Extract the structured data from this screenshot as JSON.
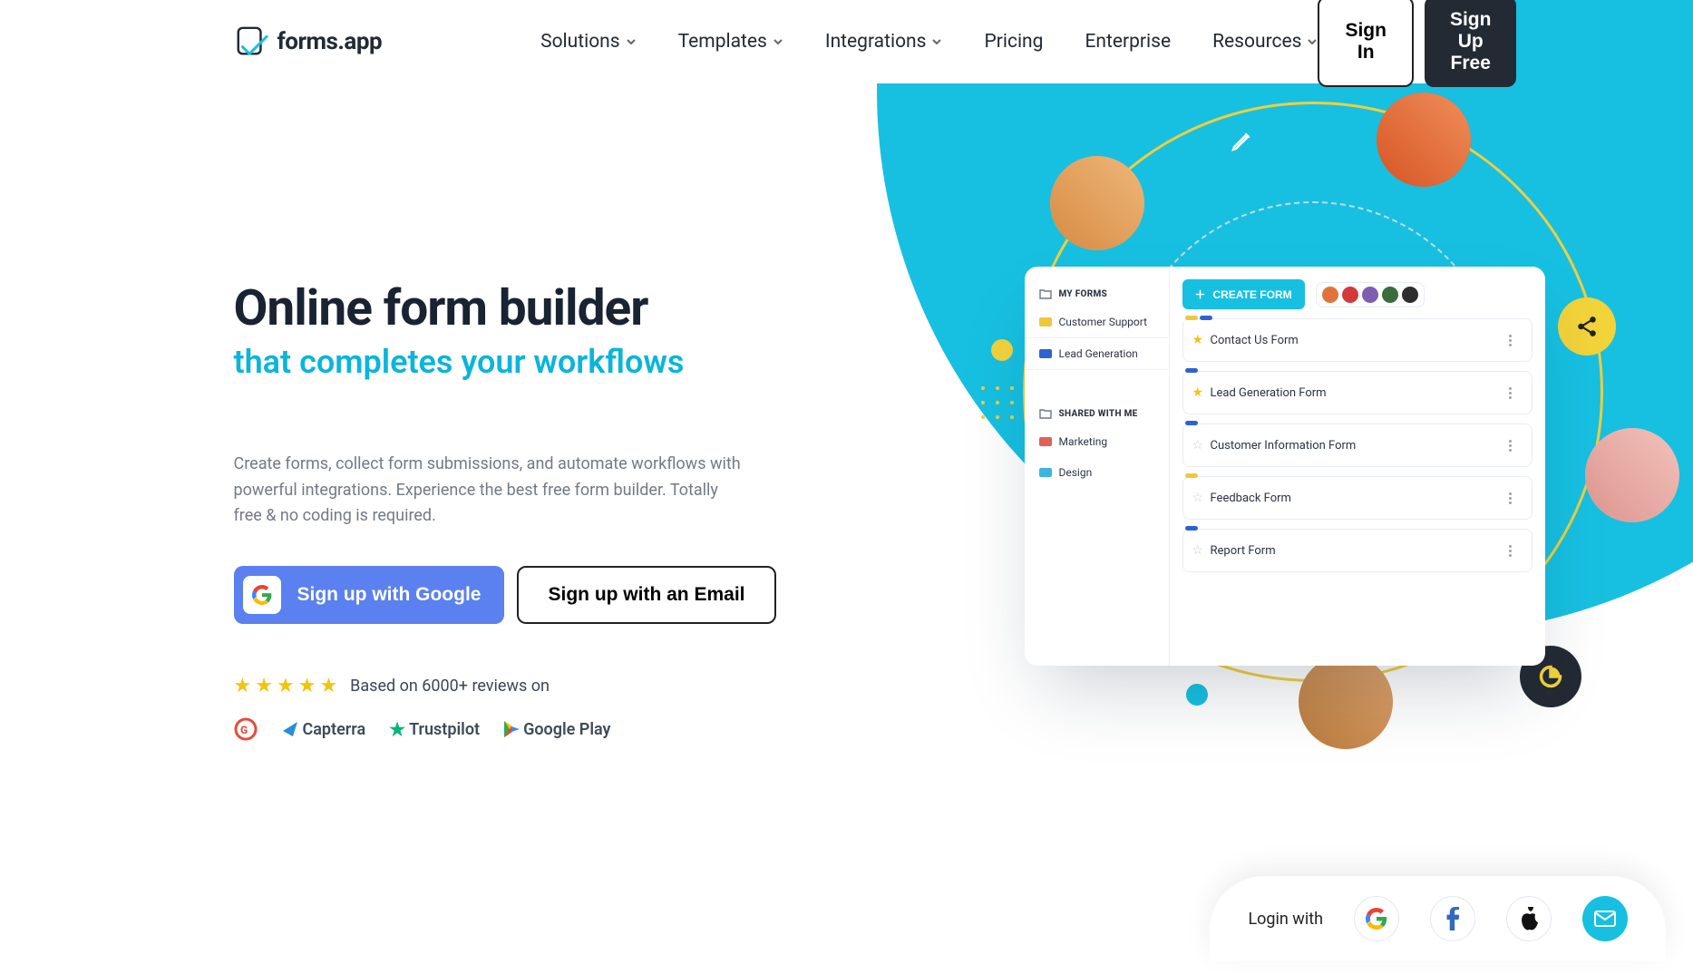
{
  "brand": {
    "name": "forms.app"
  },
  "nav": {
    "items": [
      {
        "label": "Solutions",
        "dropdown": true
      },
      {
        "label": "Templates",
        "dropdown": true
      },
      {
        "label": "Integrations",
        "dropdown": true
      },
      {
        "label": "Pricing",
        "dropdown": false
      },
      {
        "label": "Enterprise",
        "dropdown": false
      },
      {
        "label": "Resources",
        "dropdown": true
      }
    ],
    "sign_in": "Sign In",
    "sign_up": "Sign Up Free"
  },
  "hero": {
    "headline": "Online form builder",
    "headline_sub": "that completes your workflows",
    "sub": "Create forms, collect form submissions, and automate workflows with powerful integrations. Experience the best free form builder. Totally free & no coding is required.",
    "cta_google": "Sign up with Google",
    "cta_email": "Sign up with an Email",
    "rating_text": "Based on 6000+ reviews on",
    "review_sources": [
      "G2",
      "Capterra",
      "Trustpilot",
      "Google Play"
    ]
  },
  "dashboard": {
    "my_forms_label": "MY FORMS",
    "shared_label": "SHARED WITH ME",
    "create_label": "CREATE FORM",
    "folders_my": [
      {
        "label": "Customer Support",
        "color": "#f0c63d"
      },
      {
        "label": "Lead Generation",
        "color": "#2f62d0"
      }
    ],
    "folders_shared": [
      {
        "label": "Marketing",
        "color": "#e26055"
      },
      {
        "label": "Design",
        "color": "#3db5e0"
      }
    ],
    "collaborator_colors": [
      {
        "c": "#e0733c"
      },
      {
        "c": "#d23a3a"
      },
      {
        "c": "#7c5fb2"
      },
      {
        "c": "#3a6d3a"
      },
      {
        "c": "#2e2e2e"
      }
    ],
    "forms": [
      {
        "title": "Contact Us Form",
        "starred": true,
        "pills": [
          "#f0c63d",
          "#2f62d0"
        ]
      },
      {
        "title": "Lead Generation Form",
        "starred": true,
        "pills": [
          "#2f62d0"
        ]
      },
      {
        "title": "Customer Information Form",
        "starred": false,
        "pills": [
          "#2f62d0"
        ]
      },
      {
        "title": "Feedback Form",
        "starred": false,
        "pills": [
          "#f0c63d"
        ]
      },
      {
        "title": "Report Form",
        "starred": false,
        "pills": [
          "#2f62d0"
        ]
      }
    ]
  },
  "loginbar": {
    "label": "Login with",
    "providers": [
      "google",
      "facebook",
      "apple",
      "email"
    ]
  }
}
